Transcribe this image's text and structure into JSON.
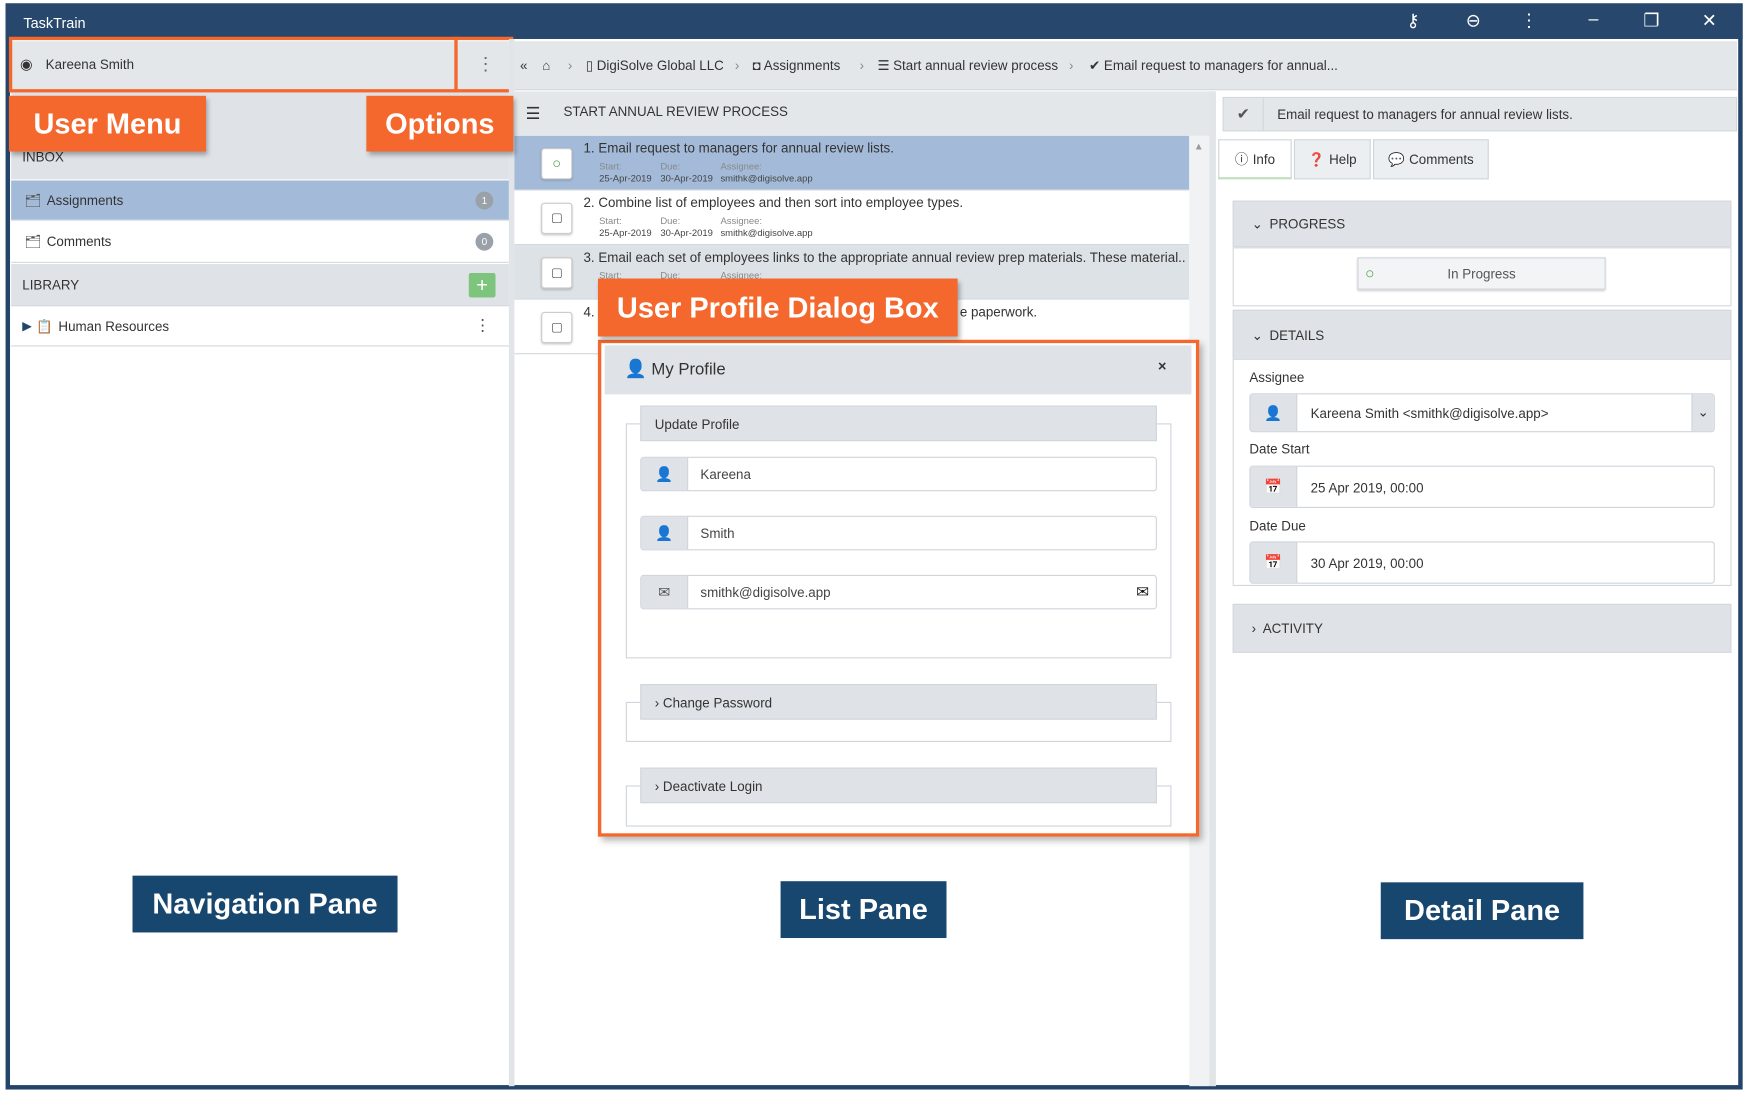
{
  "app": {
    "title": "TaskTrain"
  },
  "titlebar": {
    "icons": [
      "key-icon",
      "zoom-out-icon",
      "more-vertical-icon",
      "minimize-icon",
      "restore-icon",
      "close-icon"
    ]
  },
  "nav": {
    "user_name": "Kareena Smith",
    "inbox_header": "INBOX",
    "items": [
      {
        "label": "Assignments",
        "count": "1",
        "selected": true
      },
      {
        "label": "Comments",
        "count": "0",
        "selected": false
      }
    ],
    "library_header": "LIBRARY",
    "library_items": [
      {
        "label": "Human Resources"
      }
    ]
  },
  "breadcrumb": [
    {
      "label": "DigiSolve Global LLC",
      "icon": "building-icon"
    },
    {
      "label": "Assignments",
      "icon": "inbox-icon"
    },
    {
      "label": "Start annual review process",
      "icon": "list-icon"
    },
    {
      "label": "Email request to managers for annual...",
      "icon": "check-icon"
    }
  ],
  "list": {
    "title": "START ANNUAL REVIEW PROCESS",
    "start_label": "Start:",
    "due_label": "Due:",
    "assignee_label": "Assignee:",
    "items": [
      {
        "title": "1.  Email request to managers for annual review lists.",
        "start": "25-Apr-2019",
        "due": "30-Apr-2019",
        "assignee": "smithk@digisolve.app",
        "status": "in-progress"
      },
      {
        "title": "2.  Combine list of employees and then sort into employee types.",
        "start": "25-Apr-2019",
        "due": "30-Apr-2019",
        "assignee": "smithk@digisolve.app",
        "status": "open"
      },
      {
        "title": "3.  Email each set of employees links to the appropriate annual review prep materials. These material...",
        "status": "open"
      },
      {
        "title": "4.",
        "title_tail": "e paperwork.",
        "status": "open"
      }
    ]
  },
  "dialog": {
    "title": "My Profile",
    "close": "×",
    "update_profile": "Update Profile",
    "first_name": "Kareena",
    "last_name": "Smith",
    "email": "smithk@digisolve.app",
    "change_password": "Change Password",
    "deactivate_login": "Deactivate Login"
  },
  "detail": {
    "title": "Email request to managers for annual review lists.",
    "tabs": [
      "Info",
      "Help",
      "Comments"
    ],
    "progress_header": "PROGRESS",
    "progress_status": "In Progress",
    "details_header": "DETAILS",
    "assignee_label": "Assignee",
    "assignee": "Kareena Smith <smithk@digisolve.app>",
    "date_start_label": "Date Start",
    "date_start": "25 Apr 2019, 00:00",
    "date_due_label": "Date Due",
    "date_due": "30 Apr 2019, 00:00",
    "activity_header": "ACTIVITY"
  },
  "annotations": {
    "user_menu": "User Menu",
    "options": "Options",
    "dialog": "User Profile Dialog Box",
    "nav_pane": "Navigation Pane",
    "list_pane": "List Pane",
    "detail_pane": "Detail Pane"
  },
  "colors": {
    "titlebar": "#27486c",
    "selected": "#a3bbd9",
    "annotation_orange": "#f4682d",
    "annotation_navy": "#17466e",
    "progress_green": "#3a9a3a",
    "add_green": "#7dc47d"
  }
}
